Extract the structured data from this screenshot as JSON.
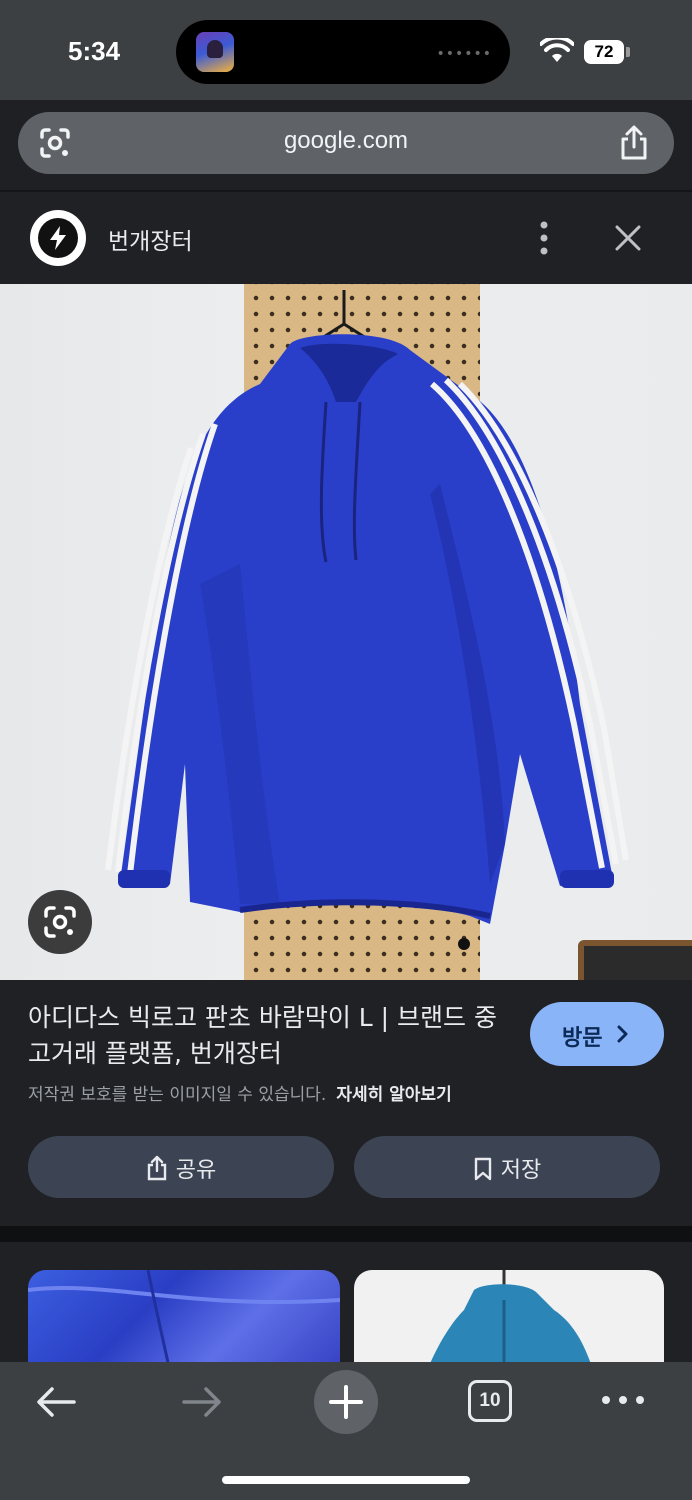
{
  "status_bar": {
    "time": "5:34",
    "battery": "72",
    "island_app_icon": "smiley-app-icon",
    "icons": [
      "wifi-icon",
      "battery-icon"
    ]
  },
  "url_bar": {
    "url": "google.com",
    "left_icon": "google-lens-icon",
    "right_icon": "share-icon"
  },
  "site": {
    "name": "번개장터",
    "logo_icon": "lightning-logo-icon",
    "menu_icon": "more-vert-icon",
    "close_icon": "close-icon"
  },
  "result": {
    "title": "아디다스 빅로고 판초 바람막이 L | 브랜드 중고거래 플랫폼, 번개장터",
    "visit_label": "방문",
    "copyright_notice": "저작권 보호를 받는 이미지일 수 있습니다.",
    "learn_more": "자세히 알아보기",
    "share_label": "공유",
    "save_label": "저장",
    "lens_icon": "google-lens-icon"
  },
  "colors": {
    "accent": "#8ab4f8",
    "jacket_blue": "#2a3fc9",
    "background": "#202124"
  },
  "toolbar": {
    "tab_count": "10",
    "icons": [
      "back-arrow-icon",
      "forward-arrow-icon",
      "new-tab-plus-icon",
      "tab-switcher-icon",
      "more-horiz-icon"
    ]
  }
}
